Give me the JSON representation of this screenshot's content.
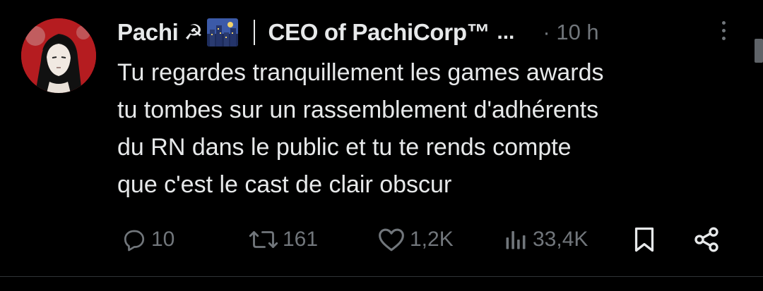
{
  "tweet": {
    "display_name": "Pachi",
    "name_emoji": "☭",
    "bio_short": "CEO of PachiCorp™",
    "ellipsis": "...",
    "timestamp": "· 10 h",
    "text_lines": [
      "Tu regardes tranquillement les games awards",
      "tu tombes sur un rassemblement d'adhérents",
      "du RN dans le public et tu te rends compte",
      "que c'est le cast de clair obscur"
    ]
  },
  "actions": {
    "replies": "10",
    "reposts": "161",
    "likes": "1,2K",
    "views": "33,4K"
  },
  "icons": {
    "avatar": "avatar-image",
    "more": "more-vertical-icon",
    "reply": "reply-icon",
    "repost": "repost-icon",
    "like": "heart-icon",
    "views": "views-icon",
    "bookmark": "bookmark-icon",
    "share": "share-icon"
  },
  "colors": {
    "background": "#000000",
    "text": "#e7e9ea",
    "muted": "#71767b",
    "avatar_red": "#b51c20"
  }
}
